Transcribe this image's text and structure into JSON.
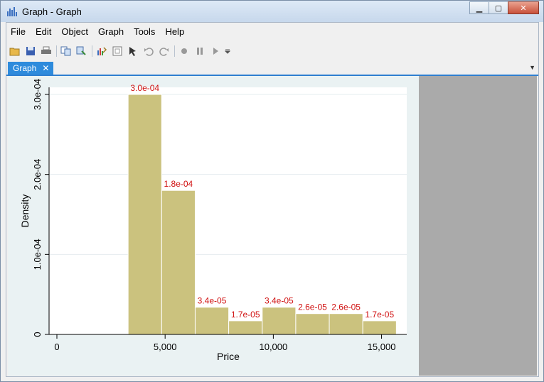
{
  "window": {
    "title": "Graph - Graph"
  },
  "menu": [
    "File",
    "Edit",
    "Object",
    "Graph",
    "Tools",
    "Help"
  ],
  "toolbar_icons": [
    "open-icon",
    "save-icon",
    "print-icon",
    "copy-icon",
    "copy-graph-icon",
    "graph-editor-icon",
    "recorder-icon",
    "pointer-icon",
    "undo-icon",
    "redo-icon",
    "record-icon",
    "pause-icon",
    "play-icon",
    "dropdown-icon"
  ],
  "tab": {
    "label": "Graph",
    "close": "✕"
  },
  "chart_data": {
    "type": "bar",
    "subtype": "histogram",
    "xlabel": "Price",
    "ylabel": "Density",
    "xlim": [
      0,
      16000
    ],
    "ylim": [
      0,
      0.0003
    ],
    "xticks": [
      0,
      5000,
      10000,
      15000
    ],
    "xtick_labels": [
      "0",
      "5,000",
      "10,000",
      "15,000"
    ],
    "yticks": [
      0,
      0.0001,
      0.0002,
      0.0003
    ],
    "ytick_labels": [
      "0",
      "1.0e-04",
      "2.0e-04",
      "3.0e-04"
    ],
    "bins": [
      {
        "start": 3291,
        "end": 4840,
        "value": 0.0003,
        "label": "3.0e-04"
      },
      {
        "start": 4840,
        "end": 6389,
        "value": 0.00018,
        "label": "1.8e-04"
      },
      {
        "start": 6389,
        "end": 7938,
        "value": 3.4e-05,
        "label": "3.4e-05"
      },
      {
        "start": 7938,
        "end": 9487,
        "value": 1.7e-05,
        "label": "1.7e-05"
      },
      {
        "start": 9487,
        "end": 11036,
        "value": 3.4e-05,
        "label": "3.4e-05"
      },
      {
        "start": 11036,
        "end": 12585,
        "value": 2.6e-05,
        "label": "2.6e-05"
      },
      {
        "start": 12585,
        "end": 14134,
        "value": 2.6e-05,
        "label": "2.6e-05"
      },
      {
        "start": 14134,
        "end": 15683,
        "value": 1.7e-05,
        "label": "1.7e-05"
      }
    ],
    "bar_color": "#cbc27e",
    "label_color": "#d01010",
    "grid": true
  }
}
